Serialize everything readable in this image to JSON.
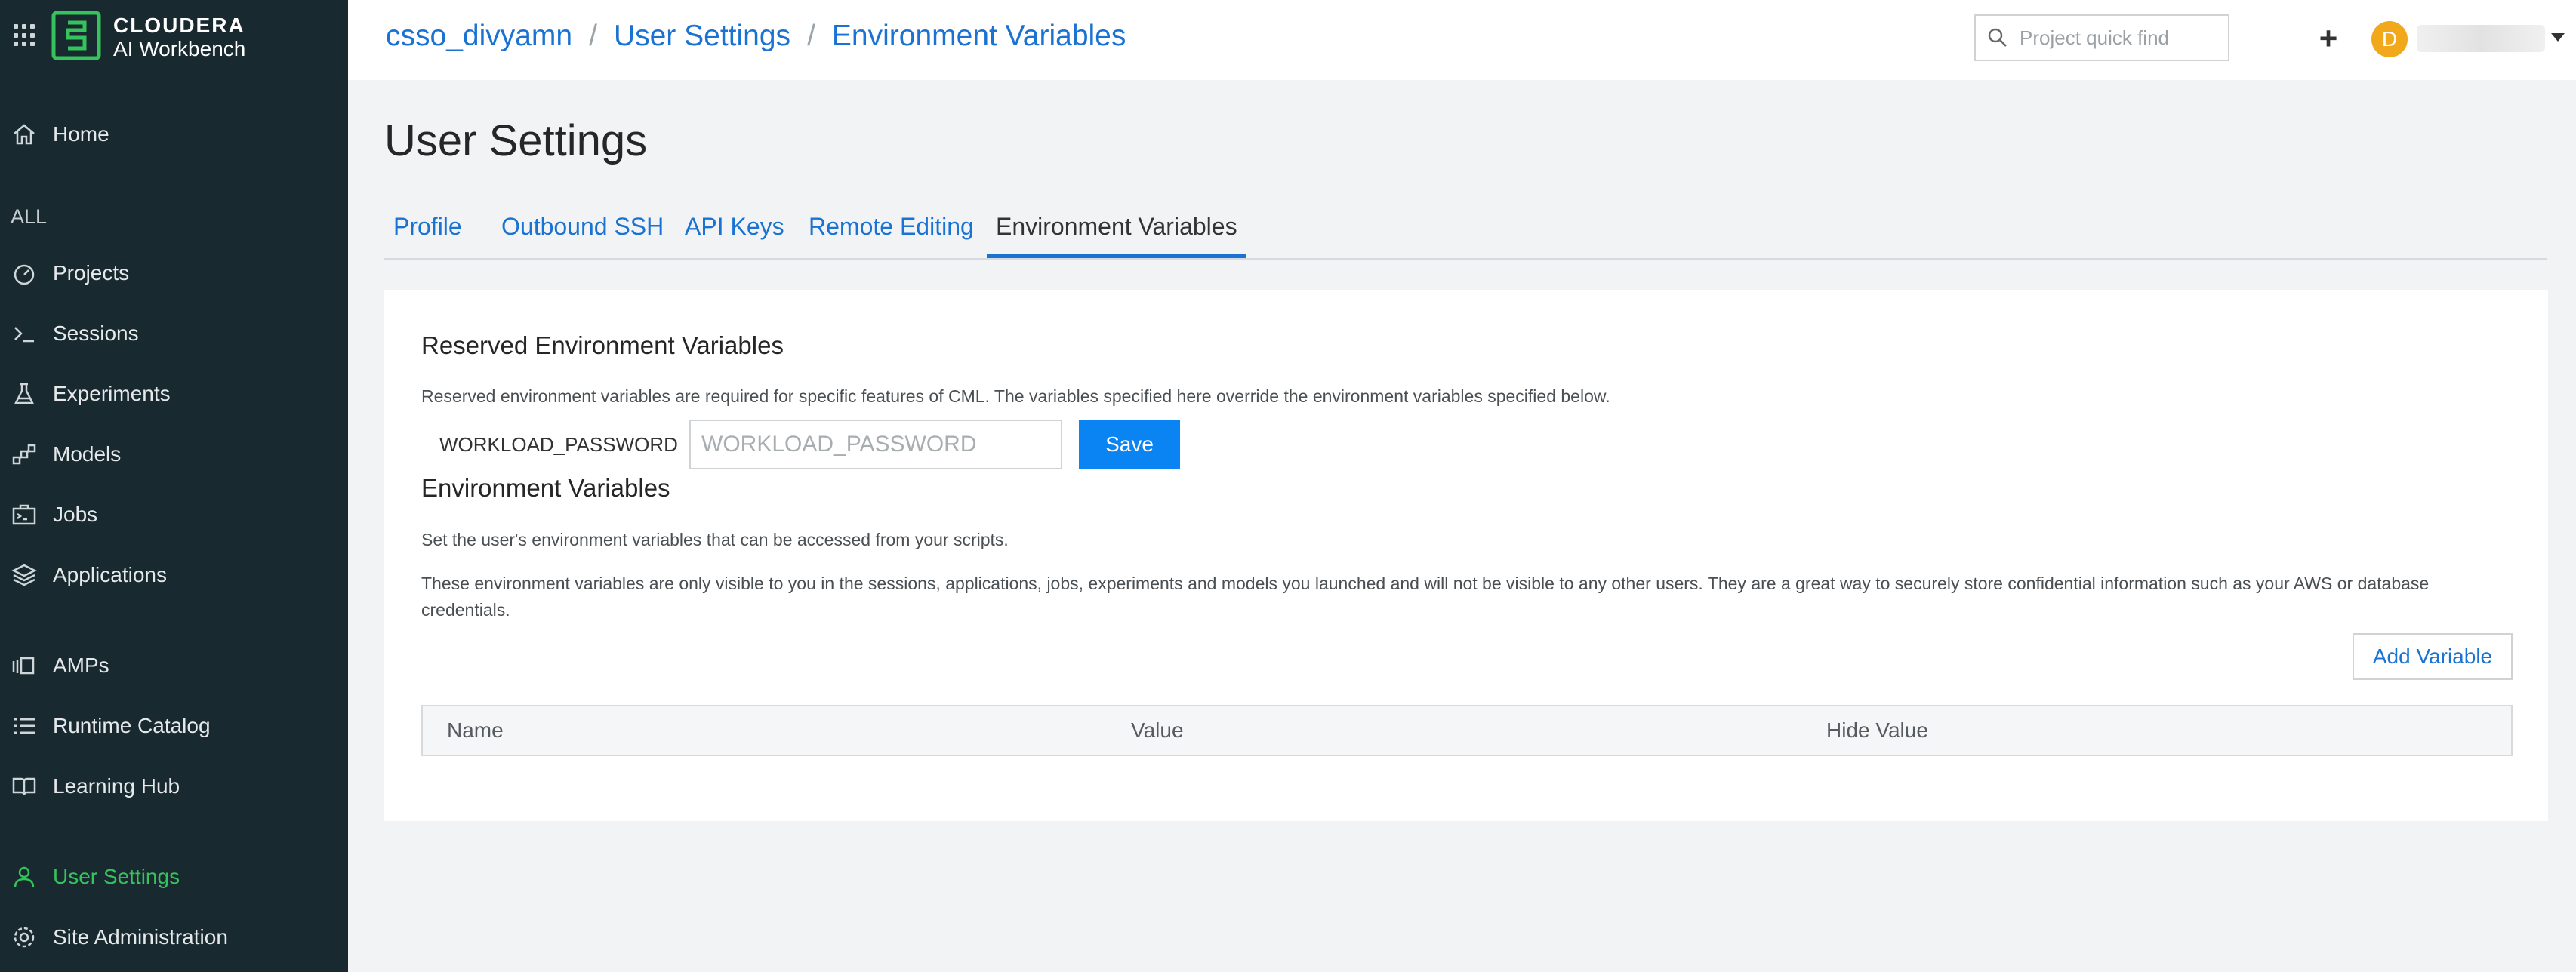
{
  "brand": {
    "line1": "CLOUDERA",
    "line2": "AI Workbench",
    "accent": "#35c35c"
  },
  "sidebar": {
    "home": "Home",
    "section_label": "ALL",
    "items": [
      {
        "label": "Projects",
        "icon": "gauge-icon"
      },
      {
        "label": "Sessions",
        "icon": "terminal-prompt-icon"
      },
      {
        "label": "Experiments",
        "icon": "flask-icon"
      },
      {
        "label": "Models",
        "icon": "model-graph-icon"
      },
      {
        "label": "Jobs",
        "icon": "briefcase-terminal-icon"
      },
      {
        "label": "Applications",
        "icon": "layers-icon"
      }
    ],
    "items2": [
      {
        "label": "AMPs",
        "icon": "amps-icon"
      },
      {
        "label": "Runtime Catalog",
        "icon": "list-icon"
      },
      {
        "label": "Learning Hub",
        "icon": "book-icon"
      }
    ],
    "user_settings": "User Settings",
    "site_admin": "Site Administration"
  },
  "breadcrumb": {
    "items": [
      "csso_divyamn",
      "User Settings",
      "Environment Variables"
    ],
    "separator": "/"
  },
  "search": {
    "placeholder": "Project quick find"
  },
  "user": {
    "avatar_initial": "D"
  },
  "page": {
    "title": "User Settings",
    "tabs": [
      "Profile",
      "Outbound SSH",
      "API Keys",
      "Remote Editing",
      "Environment Variables"
    ],
    "active_tab": "Environment Variables"
  },
  "reserved": {
    "heading": "Reserved Environment Variables",
    "description": "Reserved environment variables are required for specific features of CML. The variables specified here override the environment variables specified below.",
    "label": "WORKLOAD_PASSWORD",
    "placeholder": "WORKLOAD_PASSWORD",
    "save_label": "Save"
  },
  "env": {
    "heading": "Environment Variables",
    "desc1": "Set the user's environment variables that can be accessed from your scripts.",
    "desc2": "These environment variables are only visible to you in the sessions, applications, jobs, experiments and models you launched and will not be visible to any other users. They are a great way to securely store confidential information such as your AWS or database credentials.",
    "add_label": "Add Variable",
    "columns": [
      "Name",
      "Value",
      "Hide Value"
    ]
  }
}
